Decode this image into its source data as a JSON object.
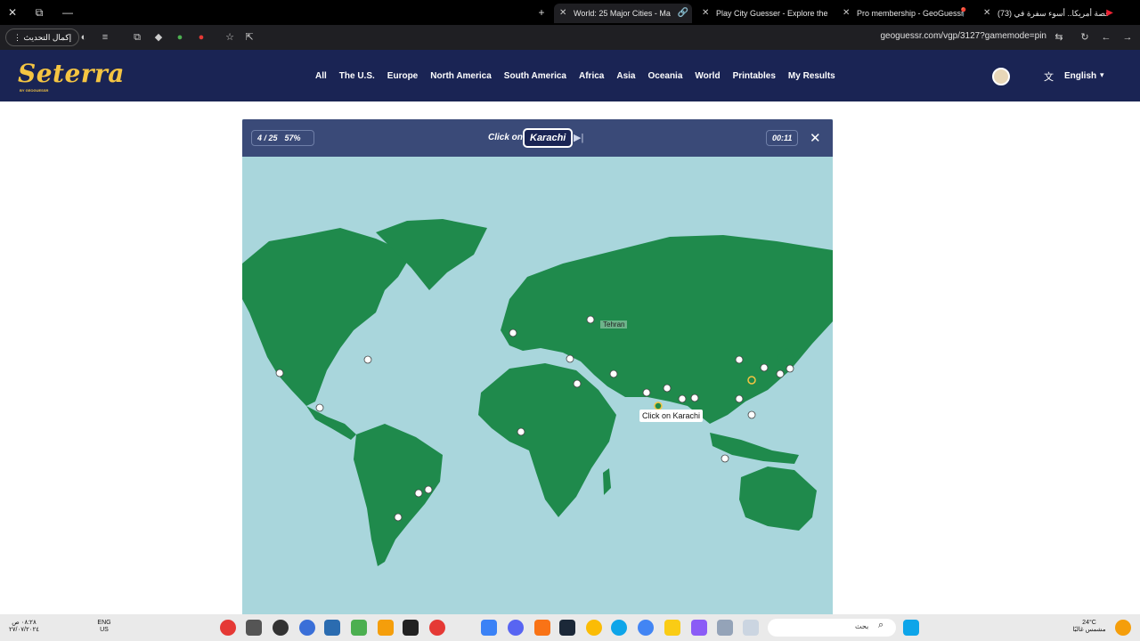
{
  "browser": {
    "tabs": [
      {
        "title": "World: 25 Major Cities - Ma",
        "active": true
      },
      {
        "title": "Play City Guesser - Explore the",
        "active": false
      },
      {
        "title": "Pro membership - GeoGuessr",
        "active": false
      },
      {
        "title": "(73) قصة أمريكا.. أسوء سفرة في",
        "active": false
      }
    ],
    "update_label": "إكمال التحديث",
    "url": "geoguessr.com/vgp/3127?gamemode=pin"
  },
  "site": {
    "logo": "Seterra",
    "logo_sub": "BY GEOGUESSR",
    "nav": [
      "All",
      "The U.S.",
      "Europe",
      "North America",
      "South America",
      "Africa",
      "Asia",
      "Oceania",
      "World",
      "Printables",
      "My Results"
    ],
    "language": "English"
  },
  "game": {
    "progress": "4 / 25",
    "score": "57%",
    "prompt_prefix": "Click on",
    "target_city": "Karachi",
    "timer": "00:11",
    "map_label": "Tehran",
    "cursor_tooltip": "Click on Karachi"
  },
  "taskbar": {
    "lang_line1": "ENG",
    "lang_line2": "US",
    "search_placeholder": "بحث",
    "weather_temp": "24°C",
    "weather_desc": "مشمس غالبًا",
    "clock_time": "٠٨:٢٨ ص",
    "clock_date": "٢٧/٠٧/٢٠٢٤"
  },
  "colors": {
    "header_bg": "#1a2454",
    "gamebar_bg": "#3a4a78",
    "ocean": "#a9d6dc",
    "land": "#1f8a4c",
    "logo": "#f5c542"
  }
}
